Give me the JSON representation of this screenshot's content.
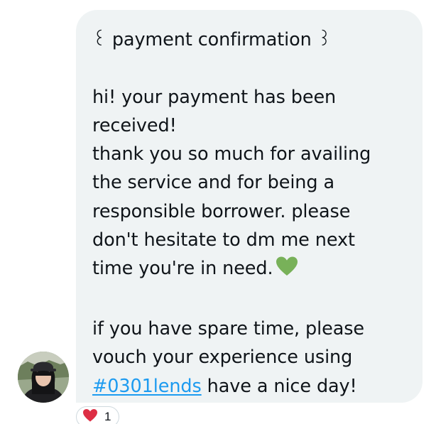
{
  "message": {
    "title_line": "꒰ payment confirmation ꒱",
    "line1": "hi! your payment has been",
    "line2": "received!",
    "line3": "thank you so much for availing",
    "line4": "the service and for being a",
    "line5": "responsible borrower. please",
    "line6": "don't hesitate to dm me next",
    "line7": "time you're in need.",
    "line8": "if you have spare time, please",
    "line9": "vouch your experience using",
    "hashtag": "#0301lends",
    "line10_rest": " have a nice day!",
    "emoji": "green-heart",
    "bubble_color": "#eff3f4",
    "link_color": "#1d9bf0"
  },
  "reaction": {
    "icon": "red-heart",
    "count": "1"
  },
  "avatar": {
    "icon": "user-avatar"
  }
}
